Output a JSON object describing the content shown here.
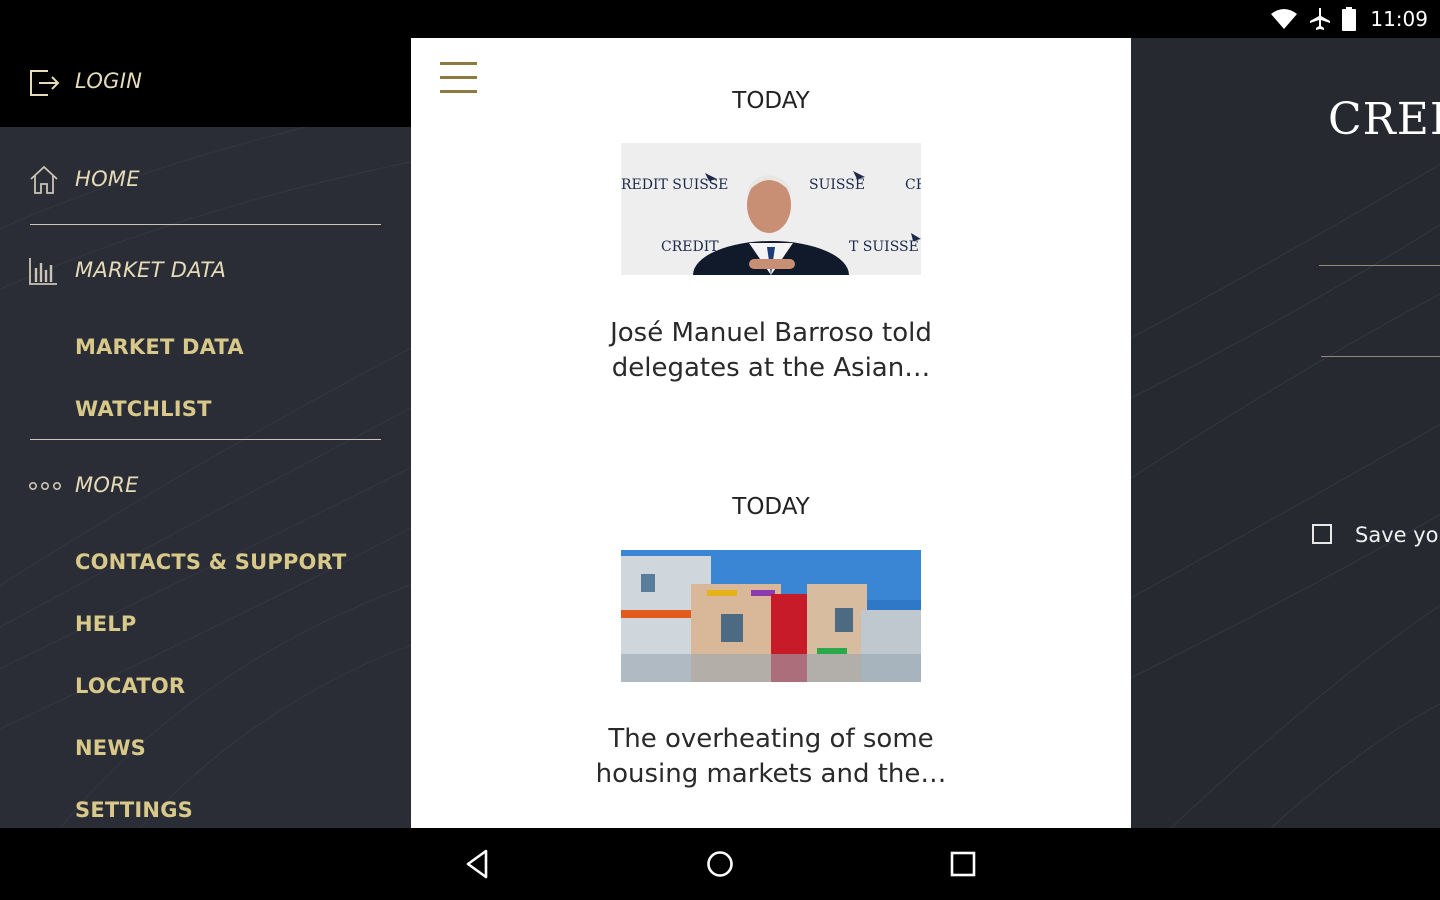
{
  "status_bar": {
    "time": "11:09",
    "icons": [
      "wifi-icon",
      "airplane-icon",
      "battery-icon"
    ]
  },
  "sidebar": {
    "login_label": "LOGIN",
    "sections": [
      {
        "label": "HOME",
        "icon": "home-icon"
      },
      {
        "label": "MARKET DATA",
        "icon": "bar-chart-icon",
        "items": [
          "MARKET DATA",
          "WATCHLIST"
        ]
      },
      {
        "label": "MORE",
        "icon": "more-dots-icon",
        "items": [
          "CONTACTS & SUPPORT",
          "HELP",
          "LOCATOR",
          "NEWS",
          "SETTINGS"
        ]
      }
    ]
  },
  "news": {
    "articles": [
      {
        "date": "TODAY",
        "image": "credit-suisse-press-conference",
        "line1": "José Manuel Barroso told",
        "line2": "delegates at the Asian…"
      },
      {
        "date": "TODAY",
        "image": "colorful-housing-buildings",
        "line1": "The overheating of some",
        "line2": "housing markets and the…"
      }
    ]
  },
  "right_panel": {
    "brand": "CRED",
    "save_label": "Save you"
  },
  "colors": {
    "sidebar_bg": "#2a2d35",
    "accent_gold": "#d8c98a",
    "news_bg": "#ffffff",
    "hamburger_gold": "#8d7a3e"
  }
}
